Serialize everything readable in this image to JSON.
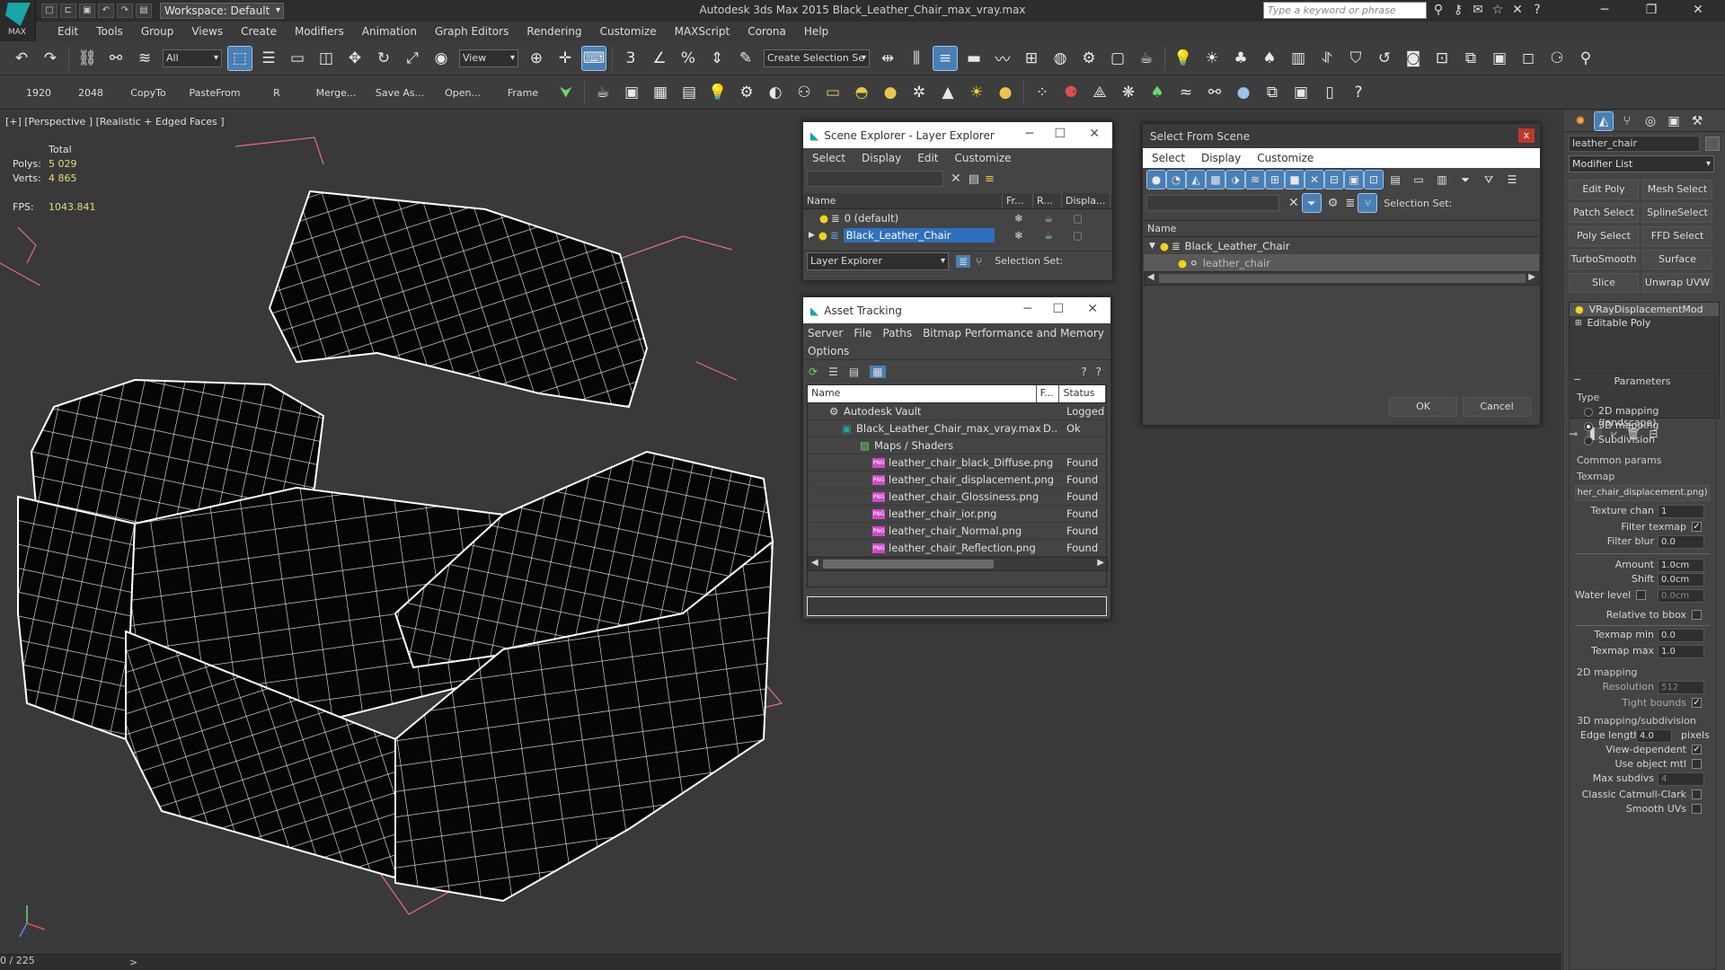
{
  "app": {
    "logo_text": "MAX",
    "workspace": "Workspace: Default",
    "title": "Autodesk 3ds Max  2015      Black_Leather_Chair_max_vray.max",
    "search_placeholder": "Type a keyword or phrase"
  },
  "menu": [
    "Edit",
    "Tools",
    "Group",
    "Views",
    "Create",
    "Modifiers",
    "Animation",
    "Graph Editors",
    "Rendering",
    "Customize",
    "MAXScript",
    "Corona",
    "Help"
  ],
  "toolbar1": {
    "selection_filter": "All",
    "ref_coord": "View",
    "named_selection": "Create Selection Se"
  },
  "toolbar2": {
    "labels": [
      "1920",
      "2048",
      "CopyTo",
      "PasteFrom",
      "R",
      "Merge...",
      "Save As...",
      "Open...",
      "Frame"
    ]
  },
  "viewport": {
    "label": "[+] [Perspective ] [Realistic + Edged Faces ]",
    "stats": {
      "total_label": "Total",
      "polys_label": "Polys:",
      "polys": "5 029",
      "verts_label": "Verts:",
      "verts": "4 865",
      "fps_label": "FPS:",
      "fps": "1043.841"
    }
  },
  "timeline": {
    "counter": "0 / 225",
    "next": ">"
  },
  "scene_explorer": {
    "title": "Scene Explorer - Layer Explorer",
    "menu": [
      "Select",
      "Display",
      "Edit",
      "Customize"
    ],
    "columns": [
      "Name",
      "Fr...",
      "R...",
      "Displa..."
    ],
    "rows": [
      {
        "name": "0 (default)",
        "selected": false
      },
      {
        "name": "Black_Leather_Chair",
        "selected": true
      }
    ],
    "mode": "Layer Explorer",
    "selection_set_label": "Selection Set:"
  },
  "asset_tracking": {
    "title": "Asset Tracking",
    "menu": [
      "Server",
      "File",
      "Paths",
      "Bitmap Performance and Memory"
    ],
    "menu2": "Options",
    "columns": [
      "Name",
      "F...",
      "Status"
    ],
    "rows": [
      {
        "name": "Autodesk Vault",
        "f": "",
        "status": "Logged"
      },
      {
        "name": "Black_Leather_Chair_max_vray.max",
        "f": "D..",
        "status": "Ok"
      },
      {
        "name": "Maps / Shaders",
        "f": "",
        "status": ""
      },
      {
        "name": "leather_chair_black_Diffuse.png",
        "f": "",
        "status": "Found"
      },
      {
        "name": "leather_chair_displacement.png",
        "f": "",
        "status": "Found"
      },
      {
        "name": "leather_chair_Glossiness.png",
        "f": "",
        "status": "Found"
      },
      {
        "name": "leather_chair_ior.png",
        "f": "",
        "status": "Found"
      },
      {
        "name": "leather_chair_Normal.png",
        "f": "",
        "status": "Found"
      },
      {
        "name": "leather_chair_Reflection.png",
        "f": "",
        "status": "Found"
      }
    ],
    "png_badge": "PNG"
  },
  "select_from_scene": {
    "title": "Select From Scene",
    "close": "x",
    "menu": [
      "Select",
      "Display",
      "Customize"
    ],
    "selection_set_label": "Selection Set:",
    "column": "Name",
    "tree": [
      {
        "name": "Black_Leather_Chair",
        "level": 0
      },
      {
        "name": "leather_chair",
        "level": 1
      }
    ],
    "ok": "OK",
    "cancel": "Cancel"
  },
  "command_panel": {
    "object_name": "leather_chair",
    "modifier_list": "Modifier List",
    "buttons": [
      "Edit Poly",
      "Mesh Select",
      "Patch Select",
      "SplineSelect",
      "Poly Select",
      "FFD Select",
      "TurboSmooth",
      "Surface Select",
      "Slice",
      "Unwrap UVW"
    ],
    "stack": [
      "VRayDisplacementMod",
      "Editable Poly"
    ],
    "rollout_title": "Parameters",
    "type_label": "Type",
    "type_options": [
      "2D mapping (landscape)",
      "3D mapping",
      "Subdivision"
    ],
    "common_label": "Common params",
    "texmap_label": "Texmap",
    "texmap_value": "her_chair_displacement.png)",
    "texture_chan_label": "Texture chan",
    "texture_chan": "1",
    "filter_texmap_label": "Filter texmap",
    "filter_blur_label": "Filter blur",
    "filter_blur": "0.0",
    "amount_label": "Amount",
    "amount": "1.0cm",
    "shift_label": "Shift",
    "shift": "0.0cm",
    "water_label": "Water level",
    "water": "0.0cm",
    "relative_label": "Relative to bbox",
    "texmap_min_label": "Texmap min",
    "texmap_min": "0.0",
    "texmap_max_label": "Texmap max",
    "texmap_max": "1.0",
    "map2d_label": "2D mapping",
    "resolution_label": "Resolution",
    "resolution": "512",
    "tight_label": "Tight bounds",
    "map3d_label": "3D mapping/subdivision",
    "edge_label": "Edge length",
    "edge": "4.0",
    "pixels": "pixels",
    "viewdep_label": "View-dependent",
    "useobj_label": "Use object mtl",
    "maxsub_label": "Max subdivs",
    "maxsub": "4",
    "catmull_label": "Classic Catmull-Clark",
    "smoothuv_label": "Smooth UVs"
  }
}
